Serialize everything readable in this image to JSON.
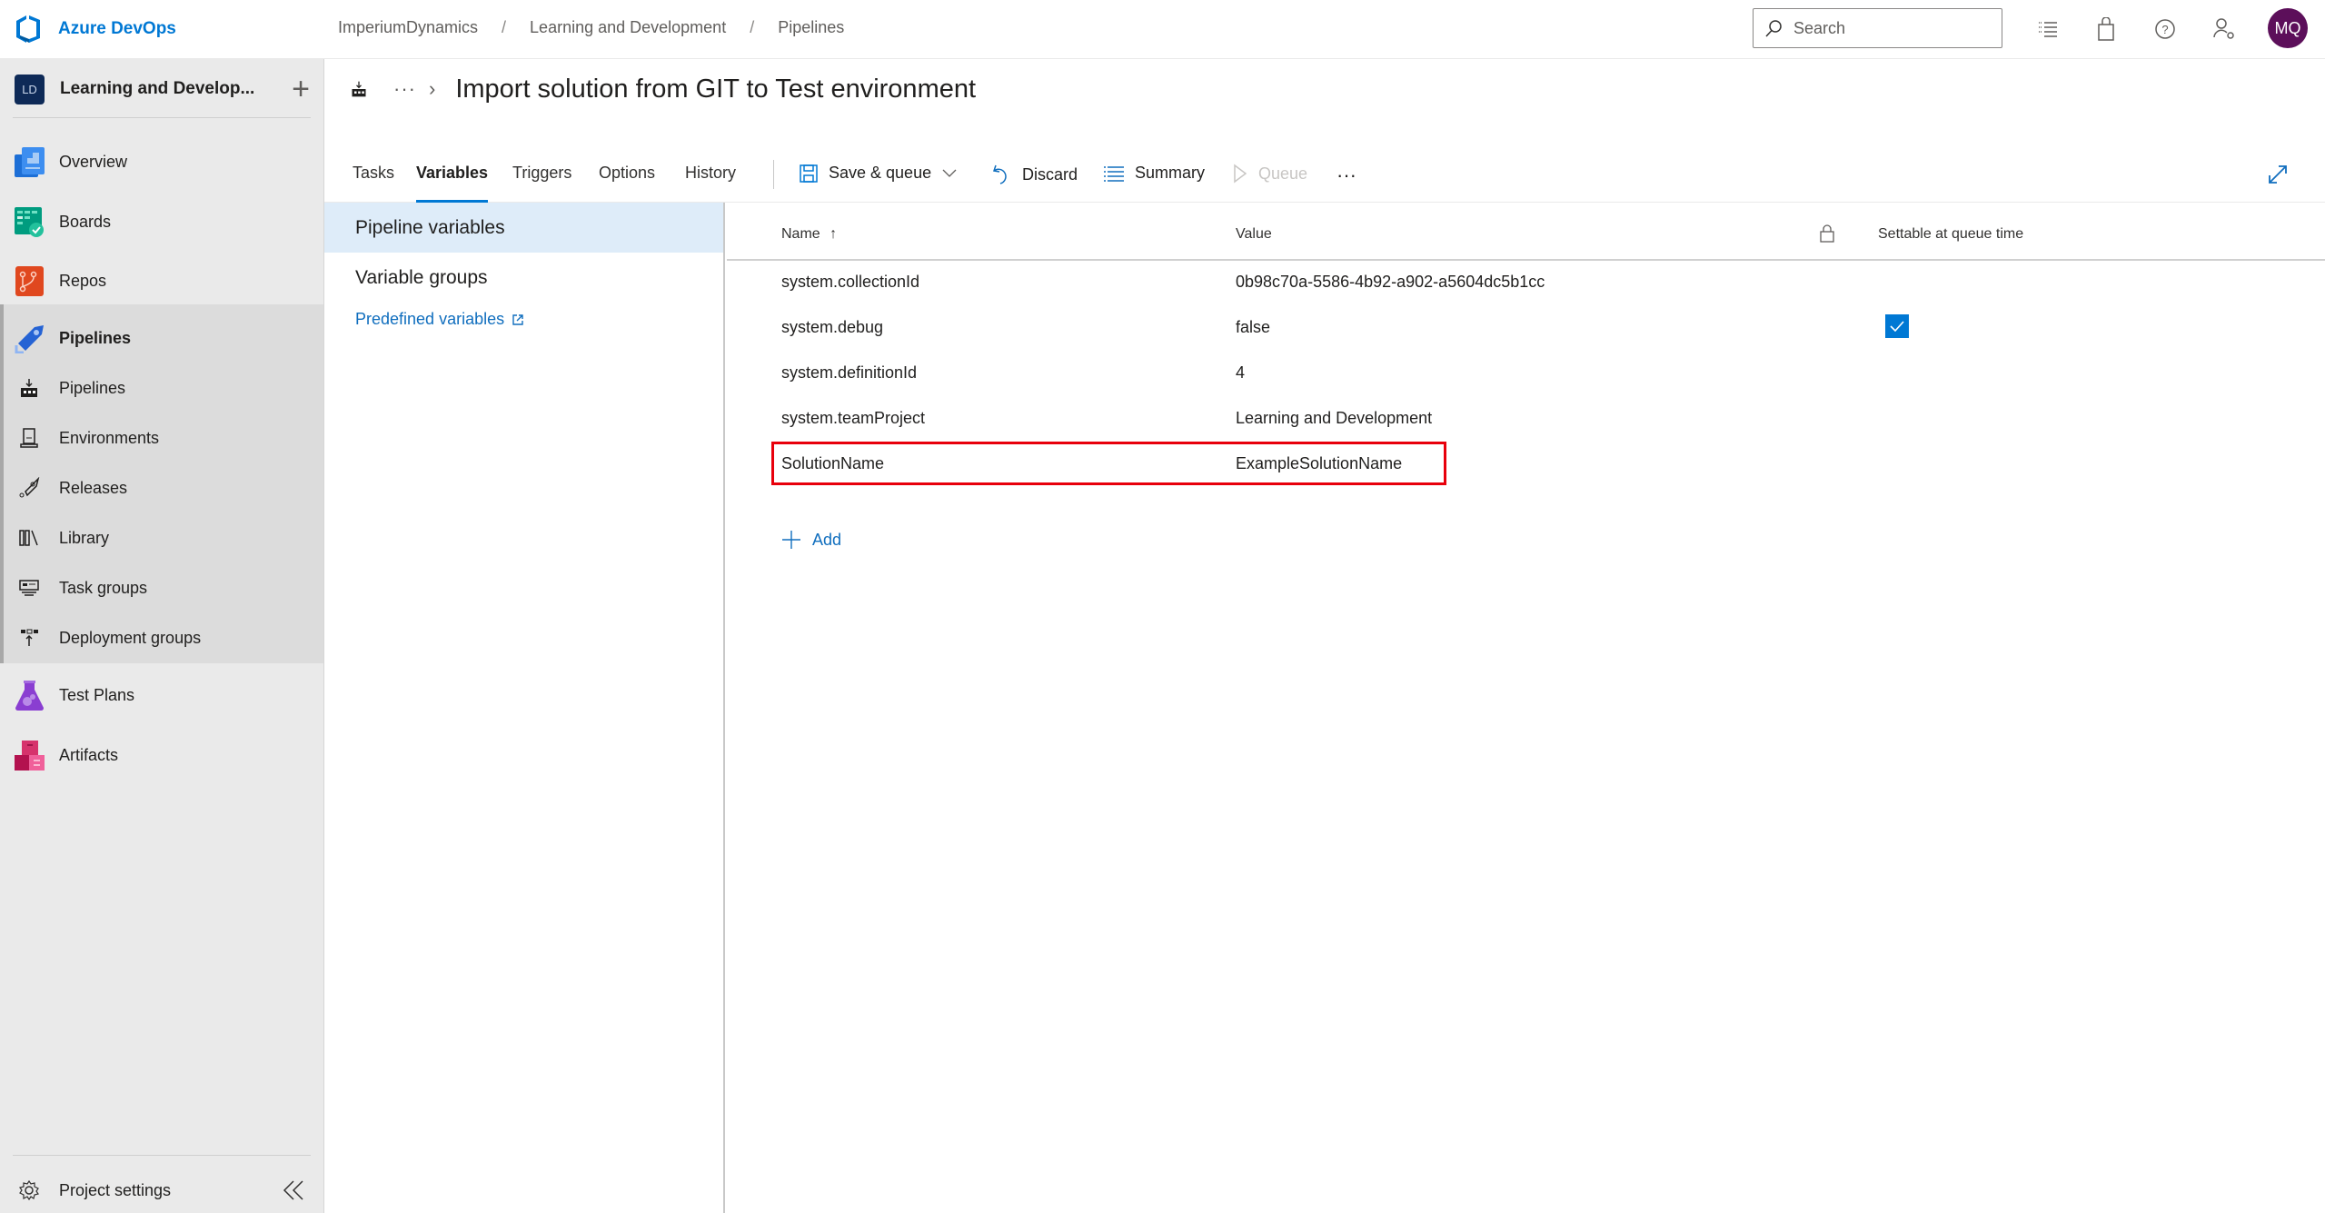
{
  "app": {
    "name": "Azure DevOps"
  },
  "breadcrumb": [
    "ImperiumDynamics",
    "Learning and Development",
    "Pipelines"
  ],
  "breadcrumb_separator": "/",
  "search": {
    "placeholder": "Search"
  },
  "user": {
    "initials": "MQ"
  },
  "colors": {
    "accent": "#0078d4",
    "highlight_box": "#e8000b",
    "avatar": "#5c0f5a",
    "project_badge": "#0e2a57"
  },
  "project": {
    "initials": "LD",
    "name": "Learning and Develop...",
    "add_icon": "plus-icon"
  },
  "sidebar": {
    "items": [
      {
        "label": "Overview",
        "icon": "overview-icon"
      },
      {
        "label": "Boards",
        "icon": "boards-icon"
      },
      {
        "label": "Repos",
        "icon": "repos-icon"
      },
      {
        "label": "Pipelines",
        "icon": "pipelines-icon",
        "selected": true
      },
      {
        "label": "Test Plans",
        "icon": "test-plans-icon"
      },
      {
        "label": "Artifacts",
        "icon": "artifacts-icon"
      }
    ],
    "pipelines_sub": [
      {
        "label": "Pipelines",
        "icon": "pipelines-sub-icon"
      },
      {
        "label": "Environments",
        "icon": "environments-icon"
      },
      {
        "label": "Releases",
        "icon": "releases-icon"
      },
      {
        "label": "Library",
        "icon": "library-icon"
      },
      {
        "label": "Task groups",
        "icon": "task-groups-icon"
      },
      {
        "label": "Deployment groups",
        "icon": "deployment-groups-icon"
      }
    ],
    "settings_label": "Project settings"
  },
  "page": {
    "title": "Import solution from GIT to Test environment",
    "ellipsis": "···",
    "chevron": "›"
  },
  "tabs": [
    {
      "label": "Tasks",
      "active": false
    },
    {
      "label": "Variables",
      "active": true
    },
    {
      "label": "Triggers",
      "active": false
    },
    {
      "label": "Options",
      "active": false
    },
    {
      "label": "History",
      "active": false
    }
  ],
  "toolbar": {
    "save_queue": "Save & queue",
    "discard": "Discard",
    "summary": "Summary",
    "queue": "Queue",
    "more": "···"
  },
  "left_panel": {
    "items": [
      "Pipeline variables",
      "Variable groups"
    ],
    "selected": "Pipeline variables",
    "link": "Predefined variables"
  },
  "table": {
    "headers": {
      "name": "Name",
      "sort_indicator": "↑",
      "value": "Value",
      "settable": "Settable at queue time"
    },
    "rows": [
      {
        "name": "system.collectionId",
        "value": "0b98c70a-5586-4b92-a902-a5604dc5b1cc",
        "settable": false
      },
      {
        "name": "system.debug",
        "value": "false",
        "settable": true
      },
      {
        "name": "system.definitionId",
        "value": "4",
        "settable": false
      },
      {
        "name": "system.teamProject",
        "value": "Learning and Development",
        "settable": false
      },
      {
        "name": "SolutionName",
        "value": "ExampleSolutionName",
        "settable": false,
        "highlighted": true
      }
    ],
    "add_label": "Add"
  }
}
